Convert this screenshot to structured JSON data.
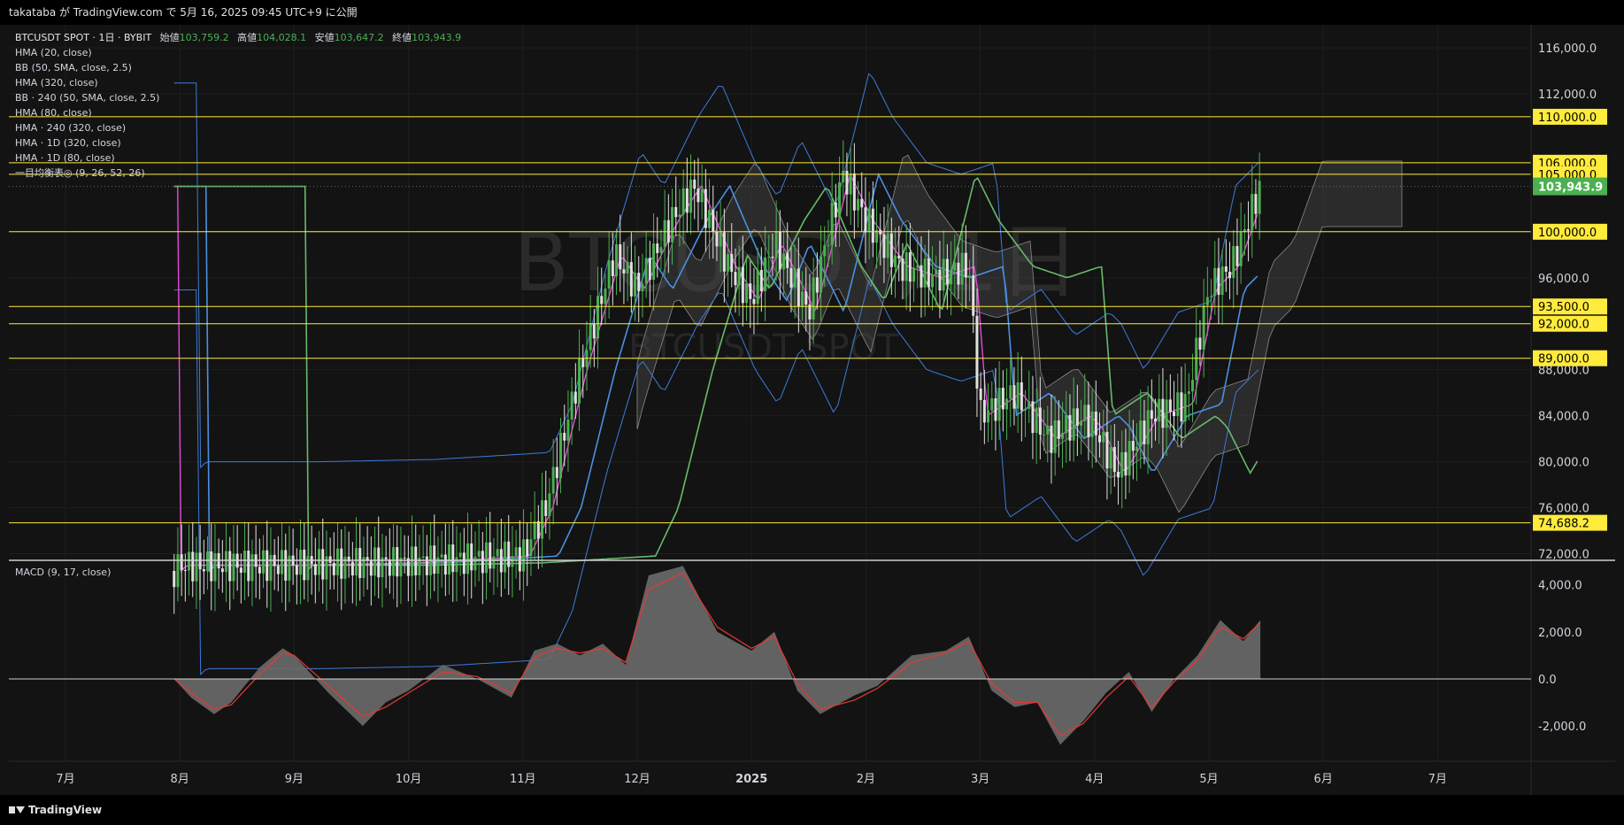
{
  "header": {
    "publish_text": "takataba が TradingView.com で 5月 16, 2025 09:45 UTC+9 に公開"
  },
  "legend": {
    "symbol": "BTCUSDT SPOT · 1日 · BYBIT",
    "open_label": "始値",
    "open": "103,759.2",
    "high_label": "高値",
    "high": "104,028.1",
    "low_label": "安値",
    "low": "103,647.2",
    "close_label": "終値",
    "close": "103,943.9",
    "indicators": [
      "HMA (20, close)",
      "BB (50, SMA, close, 2.5)",
      "HMA (320, close)",
      "BB · 240 (50, SMA, close, 2.5)",
      "HMA (80, close)",
      "HMA · 240 (320, close)",
      "HMA · 1D (320, close)",
      "HMA · 1D (80, close)",
      "一目均衡表◎ (9, 26, 52, 26)"
    ]
  },
  "watermark": {
    "big": "BTCUSDT, 1日",
    "small": "BTCUSDT SPOT"
  },
  "macd_label": "MACD (9, 17, close)",
  "footer": {
    "brand": "TradingView"
  },
  "colors": {
    "bg": "#131313",
    "grid": "#1e1e1e",
    "up": "#4caf50",
    "down": "#e0e0e0",
    "level_line": "#ffeb3b",
    "label_bg": "#ffeb3b",
    "last_price_bg": "#4caf50",
    "hma_pink": "#e34ad6",
    "hma_blue": "#4a90e2",
    "hma_green": "#66bb6a",
    "bb_blue": "#3d7bd9",
    "cloud": "#4a4a4a",
    "macd_area": "#6b6b6b",
    "signal": "#e53935"
  },
  "chart_data": [
    {
      "type": "candlestick",
      "title": "BTCUSDT SPOT · 1日 · BYBIT",
      "x_ticks": [
        "7月",
        "8月",
        "9月",
        "10月",
        "11月",
        "12月",
        "2025",
        "2月",
        "3月",
        "4月",
        "5月",
        "6月",
        "7月"
      ],
      "y_ticks": [
        "72,000.0",
        "76,000.0",
        "80,000.0",
        "84,000.0",
        "88,000.0",
        "96,000.0",
        "100,000.0",
        "112,000.0",
        "116,000.0"
      ],
      "ylim": [
        71500,
        118000
      ],
      "horizontal_levels": [
        {
          "value": 110000,
          "label": "110,000.0"
        },
        {
          "value": 106000,
          "label": "106,000.0"
        },
        {
          "value": 105000,
          "label": "105,000.0"
        },
        {
          "value": 100000,
          "label": "100,000.0"
        },
        {
          "value": 93500,
          "label": "93,500.0"
        },
        {
          "value": 92000,
          "label": "92,000.0"
        },
        {
          "value": 89000,
          "label": "89,000.0"
        },
        {
          "value": 74688.2,
          "label": "74,688.2"
        }
      ],
      "last_price": {
        "value": 103943.9,
        "label": "103,943.9"
      },
      "price_path_approx": {
        "x_month_index": [
          0.95,
          1.0,
          2.0,
          3.0,
          4.0,
          4.2,
          4.5,
          4.8,
          5.0,
          5.3,
          5.5,
          5.8,
          6.0,
          6.2,
          6.5,
          6.8,
          7.0,
          7.3,
          7.6,
          7.9,
          8.0,
          8.3,
          8.6,
          8.9,
          9.0,
          9.2,
          9.5,
          9.8,
          10.0,
          10.2,
          10.45
        ],
        "close": [
          70500,
          71000,
          71000,
          71200,
          71800,
          76000,
          88000,
          98000,
          95000,
          101000,
          104000,
          97000,
          94000,
          99000,
          93000,
          105000,
          101000,
          97000,
          96000,
          97000,
          84000,
          86000,
          82000,
          84000,
          83000,
          79000,
          84000,
          85000,
          95000,
          97000,
          103944
        ]
      }
    },
    {
      "type": "area",
      "title": "MACD (9, 17, close)",
      "y_ticks": [
        "4,000.0",
        "2,000.0",
        "0.0",
        "-2,000.0"
      ],
      "ylim": [
        -3500,
        5000
      ],
      "macd_approx": {
        "x_month_index": [
          0.95,
          1.1,
          1.3,
          1.45,
          1.7,
          1.9,
          2.0,
          2.3,
          2.6,
          2.8,
          3.0,
          3.3,
          3.6,
          3.9,
          4.1,
          4.3,
          4.5,
          4.7,
          4.9,
          5.1,
          5.4,
          5.7,
          6.0,
          6.2,
          6.4,
          6.6,
          6.9,
          7.1,
          7.4,
          7.7,
          7.9,
          8.1,
          8.3,
          8.5,
          8.7,
          8.9,
          9.1,
          9.3,
          9.5,
          9.7,
          9.9,
          10.1,
          10.3,
          10.45
        ],
        "macd": [
          0,
          -800,
          -1500,
          -1000,
          500,
          1300,
          1000,
          -600,
          -2000,
          -1000,
          -500,
          600,
          0,
          -800,
          1200,
          1500,
          1000,
          1500,
          600,
          4400,
          4800,
          2000,
          1200,
          2000,
          -500,
          -1500,
          -700,
          -300,
          1000,
          1200,
          1800,
          -500,
          -1200,
          -1000,
          -2800,
          -1800,
          -600,
          300,
          -1400,
          0,
          1000,
          2500,
          1600,
          2500
        ],
        "signal": [
          0,
          -600,
          -1300,
          -1100,
          200,
          1100,
          1000,
          -300,
          -1600,
          -1200,
          -600,
          300,
          100,
          -600,
          900,
          1300,
          1100,
          1300,
          700,
          3800,
          4500,
          2200,
          1300,
          1800,
          -200,
          -1300,
          -900,
          -400,
          700,
          1100,
          1600,
          -200,
          -1000,
          -1000,
          -2400,
          -1900,
          -800,
          100,
          -1200,
          -100,
          800,
          2200,
          1700,
          2400
        ]
      }
    }
  ]
}
